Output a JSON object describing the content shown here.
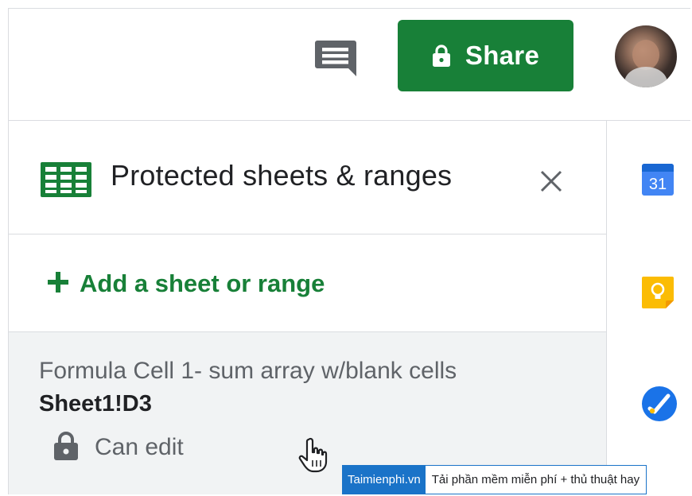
{
  "header": {
    "share_label": "Share",
    "icons": {
      "comment": "comment-icon",
      "share_lock": "lock-icon"
    }
  },
  "panel": {
    "title": "Protected sheets & ranges",
    "close_icon": "close-icon",
    "add_range_label": "Add a sheet or range",
    "items": [
      {
        "description": "Formula Cell 1- sum array w/blank cells",
        "range": "Sheet1!D3",
        "permission": "Can edit"
      }
    ]
  },
  "siderail": {
    "calendar_day": "31"
  },
  "watermark": {
    "brand": "Taimienphi.vn",
    "tagline": "Tải phần mềm miễn phí + thủ thuật hay"
  },
  "colors": {
    "accent_green": "#188038",
    "panel_item_bg": "#f1f3f4",
    "calendar_blue": "#4285f4",
    "keep_yellow": "#fbbc04",
    "watermark_blue": "#1a73c8"
  }
}
